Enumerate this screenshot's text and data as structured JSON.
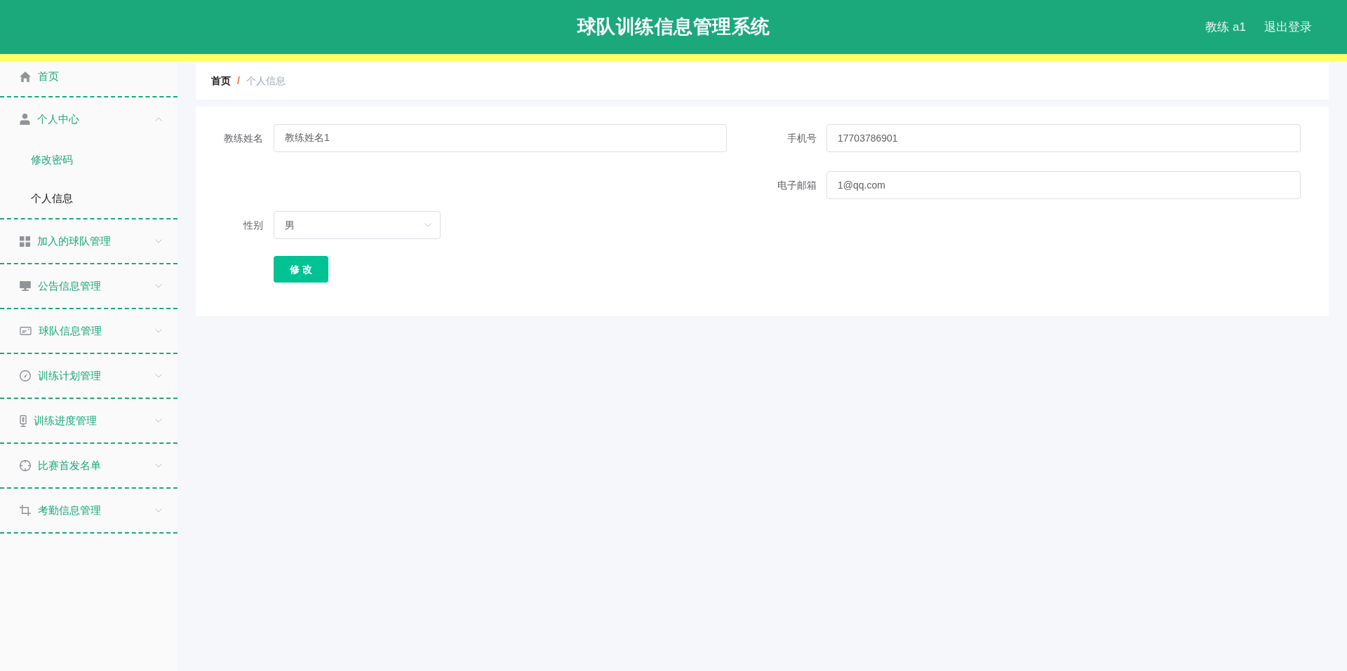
{
  "header": {
    "title": "球队训练信息管理系统",
    "user": "教练 a1",
    "logout": "退出登录"
  },
  "sidebar": {
    "items": [
      {
        "kind": "item",
        "label": "首页",
        "selected": false
      },
      {
        "kind": "submenu",
        "label": "个人中心",
        "expanded": true,
        "children": [
          {
            "label": "修改密码",
            "selected": false
          },
          {
            "label": "个人信息",
            "selected": true
          }
        ]
      },
      {
        "kind": "submenu",
        "label": "加入的球队管理",
        "expanded": false
      },
      {
        "kind": "submenu",
        "label": "公告信息管理",
        "expanded": false
      },
      {
        "kind": "submenu",
        "label": "球队信息管理",
        "expanded": false
      },
      {
        "kind": "submenu",
        "label": "训练计划管理",
        "expanded": false
      },
      {
        "kind": "submenu",
        "label": "训练进度管理",
        "expanded": false
      },
      {
        "kind": "submenu",
        "label": "比赛首发名单",
        "expanded": false
      },
      {
        "kind": "submenu",
        "label": "考勤信息管理",
        "expanded": false
      }
    ]
  },
  "breadcrumb": {
    "items": [
      "首页",
      "个人信息"
    ],
    "separator": "/"
  },
  "form": {
    "rows": [
      {
        "left": {
          "kind": "input",
          "label": "教练姓名",
          "value": "教练姓名1"
        },
        "right": {
          "kind": "input",
          "label": "手机号",
          "value": "17703786901"
        }
      },
      {
        "right": {
          "kind": "input",
          "label": "电子邮箱",
          "value": "1@qq.com"
        }
      },
      {
        "left": {
          "kind": "select",
          "label": "性别",
          "value": "男"
        }
      }
    ],
    "submit": "修 改"
  }
}
